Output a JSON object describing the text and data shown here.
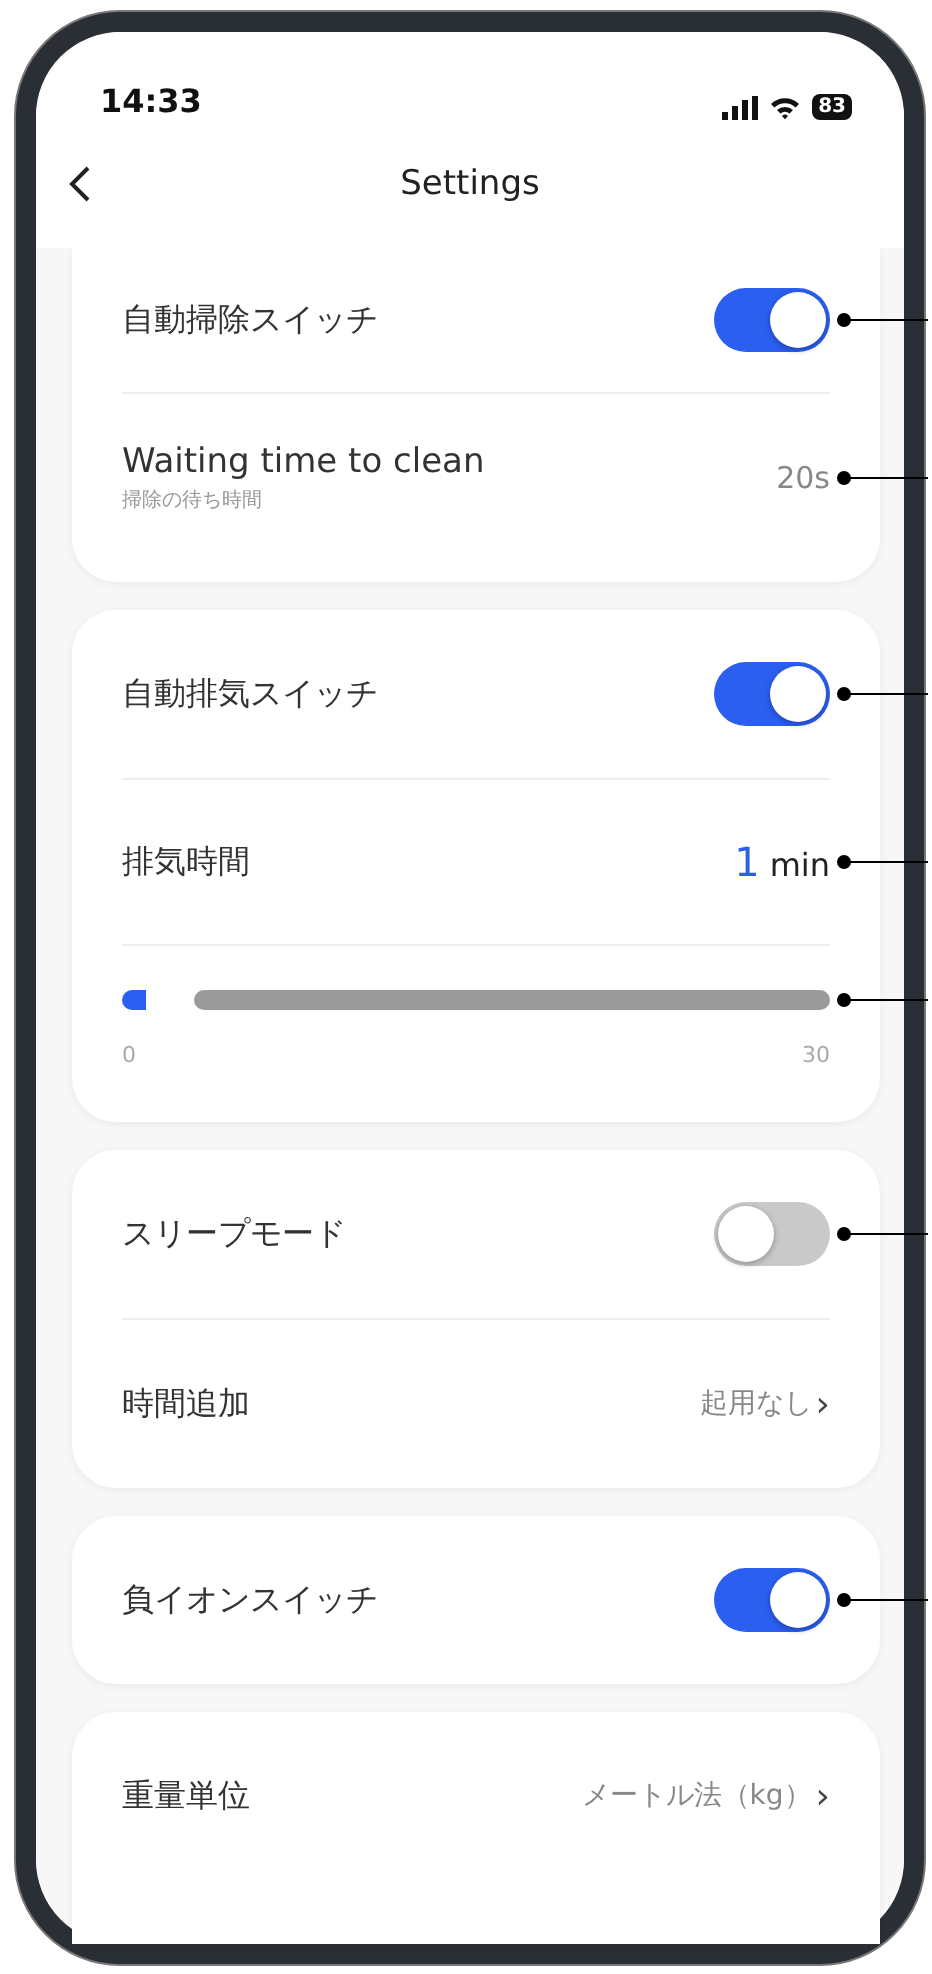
{
  "status_bar": {
    "time": "14:33",
    "battery": "83"
  },
  "header": {
    "title": "Settings"
  },
  "sections": [
    {
      "rows": [
        {
          "kind": "toggle",
          "label": "自動掃除スイッチ",
          "on": true,
          "callout": true
        },
        {
          "kind": "value",
          "label": "Waiting time to clean",
          "sublabel": "掃除の待ち時間",
          "value": "20s",
          "callout": true
        }
      ]
    },
    {
      "rows": [
        {
          "kind": "toggle",
          "label": "自動排気スイッチ",
          "on": true,
          "callout": true
        },
        {
          "kind": "amount",
          "label": "排気時間",
          "number": "1",
          "unit": "min",
          "callout": true
        },
        {
          "kind": "slider",
          "level": 0.033,
          "min_label": "0",
          "max_label": "30",
          "callout": true
        }
      ]
    },
    {
      "rows": [
        {
          "kind": "toggle",
          "label": "スリープモード",
          "on": false,
          "callout": true
        },
        {
          "kind": "link",
          "label": "時間追加",
          "value": "起用なし",
          "chevron": "›",
          "callout": false
        }
      ]
    },
    {
      "rows": [
        {
          "kind": "toggle",
          "label": "負イオンスイッチ",
          "on": true,
          "callout": true
        }
      ]
    },
    {
      "rows": [
        {
          "kind": "link",
          "label": "重量単位",
          "value": "メートル法（kg）",
          "chevron": "›",
          "callout": false
        }
      ]
    }
  ]
}
